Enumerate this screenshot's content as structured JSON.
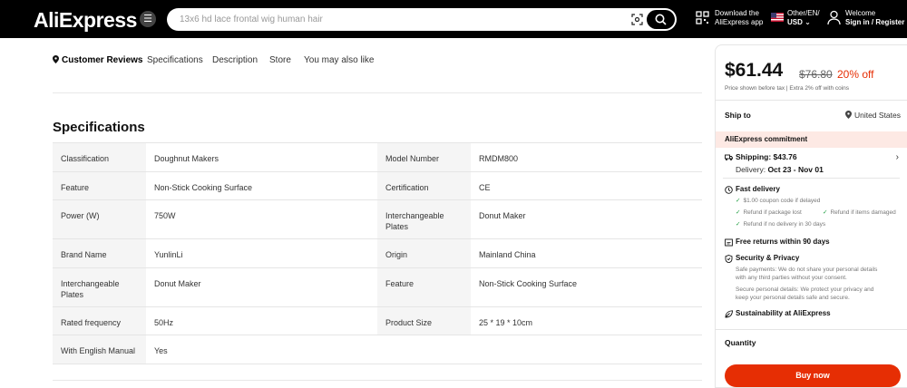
{
  "header": {
    "logo": "AliExpress",
    "search_placeholder": "13x6 hd lace frontal wig human hair",
    "download_line1": "Download the",
    "download_line2": "AliExpress app",
    "locale_line1": "Other/EN/",
    "locale_line2": "USD",
    "welcome_line1": "Welcome",
    "welcome_line2": "Sign in / Register"
  },
  "tabs": [
    {
      "label": "Customer Reviews"
    },
    {
      "label": "Specifications"
    },
    {
      "label": "Description"
    },
    {
      "label": "Store"
    },
    {
      "label": "You may also like"
    }
  ],
  "specifications": {
    "title": "Specifications",
    "rows": [
      {
        "k1": "Classification",
        "v1": "Doughnut Makers",
        "k2": "Model Number",
        "v2": "RMDM800"
      },
      {
        "k1": "Feature",
        "v1": "Non-Stick Cooking Surface",
        "k2": "Certification",
        "v2": "CE"
      },
      {
        "k1": "Power (W)",
        "v1": "750W",
        "k2": "Interchangeable Plates",
        "v2": "Donut Maker"
      },
      {
        "k1": "Brand Name",
        "v1": "YunlinLi",
        "k2": "Origin",
        "v2": "Mainland China"
      },
      {
        "k1": "Interchangeable Plates",
        "v1": "Donut Maker",
        "k2": "Feature",
        "v2": "Non-Stick Cooking Surface"
      },
      {
        "k1": "Rated frequency",
        "v1": "50Hz",
        "k2": "Product Size",
        "v2": "25 * 19 * 10cm"
      },
      {
        "k1": "With English Manual",
        "v1": "Yes",
        "k2": "",
        "v2": ""
      }
    ]
  },
  "panel": {
    "price": "$61.44",
    "original_price": "$76.80",
    "discount": "20% off",
    "tax_note": "Price shown before tax  |  Extra 2% off with coins",
    "ship_to_label": "Ship to",
    "ship_to_value": "United States",
    "commitment": "AliExpress commitment",
    "shipping": "Shipping: $43.76",
    "delivery_label": "Delivery:",
    "delivery_dates": "Oct 23 - Nov 01",
    "fast_delivery": "Fast delivery",
    "fast_items": [
      "$1.00 coupon code if delayed",
      "Refund if package lost",
      "Refund if items damaged",
      "Refund if no delivery in 30 days"
    ],
    "free_returns": "Free returns within 90 days",
    "security": "Security & Privacy",
    "security_text1a": "Safe payments: We do not share your personal details",
    "security_text1b": "with any third parties without your consent.",
    "security_text2a": "Secure personal details: We protect your privacy and",
    "security_text2b": "keep your personal details safe and secure.",
    "sustainability": "Sustainability at AliExpress",
    "quantity_label": "Quantity",
    "buy_now": "Buy now"
  },
  "colors": {
    "accent": "#e62e04",
    "header_bg": "#000000",
    "commit_bg": "#fde9e4"
  }
}
